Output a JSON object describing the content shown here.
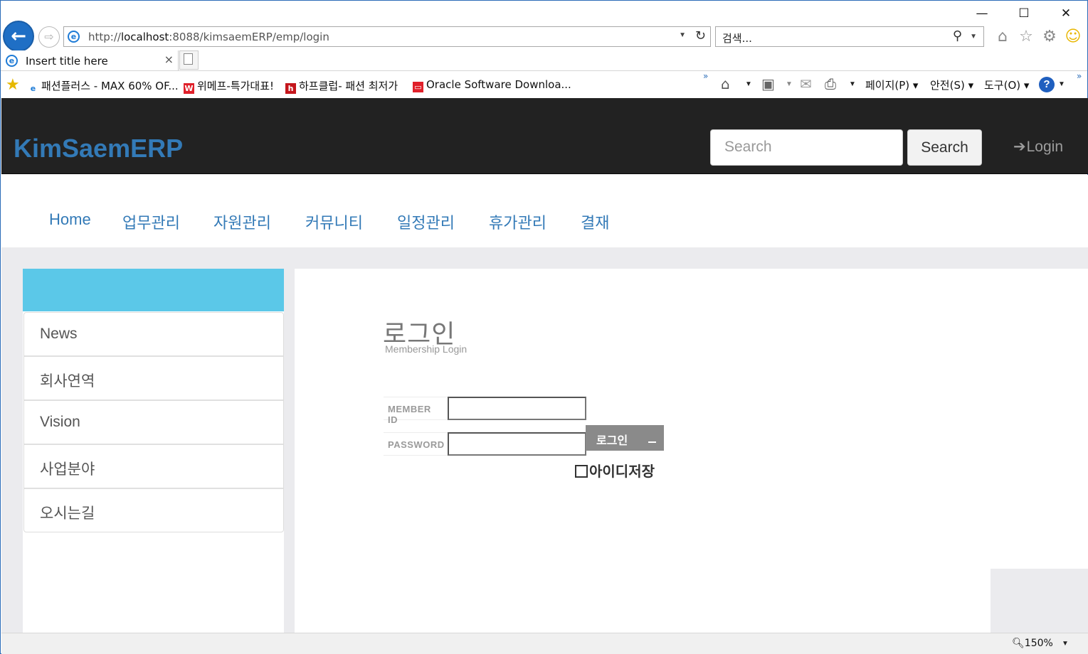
{
  "browser": {
    "window_controls": {
      "minimize": "—",
      "maximize": "☐",
      "close": "✕"
    },
    "back_icon": "←",
    "forward_icon": "⇨",
    "address": {
      "prefix": "http://",
      "host": "localhost",
      "rest": ":8088/kimsaemERP/emp/login"
    },
    "search_placeholder": "검색...",
    "tab": {
      "title": "Insert title here",
      "close": "×"
    },
    "favorites": [
      {
        "label": "패션플러스 - MAX 60% OF...",
        "icon_text": "e",
        "icon_color": "#1e7bd6"
      },
      {
        "label": "위메프-특가대표!",
        "icon_text": "W",
        "icon_color": "#e0202a"
      },
      {
        "label": "하프클럽- 패션 최저가",
        "icon_text": "h",
        "icon_color": "#c4161c"
      },
      {
        "label": "Oracle Software Downloa...",
        "icon_text": "▭",
        "icon_color": "#e0202a"
      }
    ],
    "chevron": "»",
    "commands": {
      "page": "페이지(P)",
      "safety": "안전(S)",
      "tools": "도구(O)",
      "help": "?"
    },
    "zoom": "150%"
  },
  "site": {
    "brand": "KimSaemERP",
    "search_placeholder": "Search",
    "search_button": "Search",
    "login_label": "Login",
    "menu": [
      "Home",
      "업무관리",
      "자원관리",
      "커뮤니티",
      "일정관리",
      "휴가관리",
      "결재"
    ],
    "sidebar": [
      "News",
      "회사연역",
      "Vision",
      "사업분야",
      "오시는길"
    ]
  },
  "login": {
    "title": "로그인",
    "subtitle": "Membership Login",
    "id_label": "MEMBER ID",
    "pw_label": "PASSWORD",
    "button": "로그인",
    "save_id": "아이디저장"
  },
  "colors": {
    "brand": "#337ab7",
    "sidebar_header": "#5bc8e8",
    "navbar": "#222222"
  }
}
